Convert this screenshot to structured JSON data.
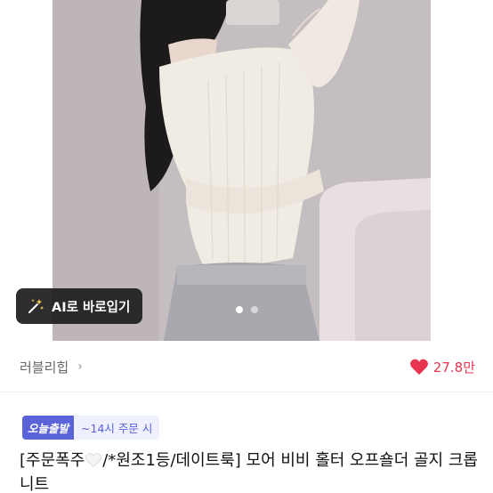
{
  "ai_button": {
    "label": "AI로 바로입기",
    "icon": "magic-wand-icon"
  },
  "carousel": {
    "total": 2,
    "current": 1
  },
  "shop": {
    "name": "러블리힙",
    "chevron": "›"
  },
  "like": {
    "count": "27.8만",
    "icon": "heart-icon",
    "color": "#e8344e"
  },
  "badges": {
    "today": "오늘출발",
    "eta": "~14시 주문 시"
  },
  "product": {
    "title_part1": "[주문폭주",
    "title_part2": "/*원조1등/데이트룩] 모어 비비 홀터 오프숄더 골지 크롭 니트"
  },
  "colors": {
    "accent": "#5b63d9",
    "badge_bg": "#eef0fd"
  }
}
